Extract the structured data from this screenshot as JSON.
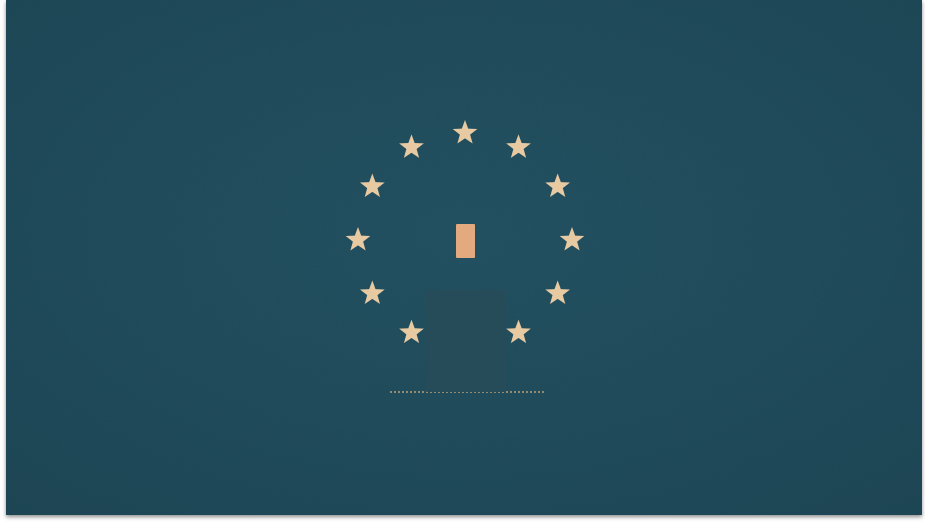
{
  "scene": {
    "background_color": "#255667",
    "background_edge_color": "#1f4a5a",
    "star_color": "#e7c9a2",
    "star_count": 11,
    "ballot_color": "#e3aa80",
    "box_color": "#1d4452",
    "ground_color": "#b99f76",
    "icons": [
      "star-icon",
      "ballot-paper",
      "ballot-box"
    ]
  }
}
